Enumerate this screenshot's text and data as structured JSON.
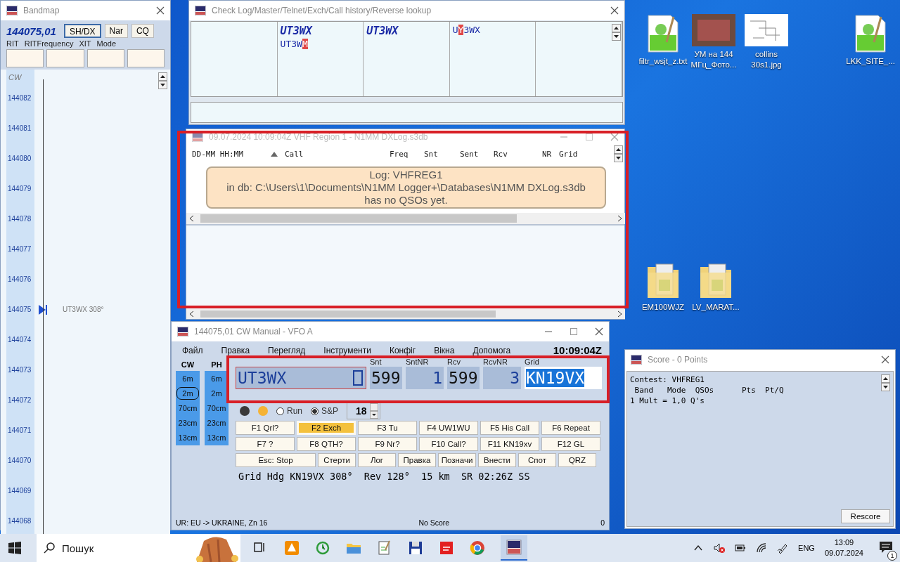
{
  "bandmap": {
    "title": "Bandmap",
    "frequency": "144075,01",
    "buttons": [
      {
        "label": "SH/DX",
        "selected": true
      },
      {
        "label": "Nar",
        "selected": false
      },
      {
        "label": "CQ",
        "selected": false
      }
    ],
    "field_labels": [
      "RIT",
      "RITFrequency",
      "XIT",
      "Mode"
    ],
    "mode": "CW",
    "scale": [
      {
        "freq": "144082"
      },
      {
        "freq": "144081"
      },
      {
        "freq": "144080"
      },
      {
        "freq": "144079"
      },
      {
        "freq": "144078"
      },
      {
        "freq": "144077"
      },
      {
        "freq": "144076"
      },
      {
        "freq": "144075",
        "spot": "UT3WX 308°"
      },
      {
        "freq": "144074"
      },
      {
        "freq": "144073"
      },
      {
        "freq": "144072"
      },
      {
        "freq": "144071"
      },
      {
        "freq": "144070"
      },
      {
        "freq": "144069"
      },
      {
        "freq": "144068"
      }
    ]
  },
  "check_log": {
    "title": "Check Log/Master/Telnet/Exch/Call history/Reverse lookup",
    "columns": [
      {},
      {
        "entries": [
          {
            "kind": "exact",
            "text": "UT3WX"
          },
          {
            "kind": "partial",
            "before": "UT3W",
            "diff": "M"
          }
        ]
      },
      {
        "entries": [
          {
            "kind": "exact",
            "text": "UT3WX"
          }
        ]
      },
      {
        "entries": [
          {
            "kind": "partial",
            "before": "U",
            "diff": "Y",
            "after": "3WX"
          }
        ]
      },
      {}
    ]
  },
  "log": {
    "title": "09.07.2024 10:09:04Z  VHF Region 1 - N1MM DXLog.s3db",
    "columns": [
      {
        "label": "DD-MM HH:MM",
        "sorted": false
      },
      {
        "label": "Call",
        "sorted": true
      },
      {
        "label": "Freq",
        "sorted": false
      },
      {
        "label": "Snt",
        "sorted": false
      },
      {
        "label": "Sent",
        "sorted": false
      },
      {
        "label": "Rcv",
        "sorted": false
      },
      {
        "label": "NR",
        "sorted": false
      },
      {
        "label": "Grid",
        "sorted": false
      }
    ],
    "message": [
      "Log: VHFREG1",
      "in db: C:\\Users\\1\\Documents\\N1MM Logger+\\Databases\\N1MM DXLog.s3db",
      "has no QSOs yet."
    ]
  },
  "entry": {
    "title": "144075,01 CW Manual - VFO A",
    "menu": [
      "Файл",
      "Правка",
      "Перегляд",
      "Інструменти",
      "Конфіг",
      "Вікна",
      "Допомога"
    ],
    "clock": "10:09:04Z",
    "band_columns": [
      {
        "label": "CW",
        "bands": [
          {
            "label": "6m",
            "selected": false
          },
          {
            "label": "2m",
            "selected": true
          },
          {
            "label": "70cm",
            "selected": false
          },
          {
            "label": "23cm",
            "selected": false
          },
          {
            "label": "13cm",
            "selected": false
          }
        ]
      },
      {
        "label": "PH",
        "bands": [
          {
            "label": "6m",
            "selected": false
          },
          {
            "label": "2m",
            "selected": false
          },
          {
            "label": "70cm",
            "selected": false
          },
          {
            "label": "23cm",
            "selected": false
          },
          {
            "label": "13cm",
            "selected": false
          }
        ]
      }
    ],
    "fields": [
      {
        "kind": "call",
        "value": "UT3WX",
        "selected": false
      },
      {
        "kind": "plain",
        "label": "Snt",
        "value": "599",
        "selected": false
      },
      {
        "kind": "number",
        "label": "SntNR",
        "value": "1",
        "selected": false
      },
      {
        "kind": "plain",
        "label": "Rcv",
        "value": "599",
        "selected": false
      },
      {
        "kind": "number",
        "label": "RcvNR",
        "value": "3",
        "selected": false
      },
      {
        "kind": "plain",
        "label": "Grid",
        "value": "KN19VX",
        "selected": true
      }
    ],
    "status_dots": [
      {
        "color": "#3a3a3a"
      },
      {
        "color": "#f5b335"
      }
    ],
    "modes": [
      {
        "label": "Run",
        "selected": false
      },
      {
        "label": "S&P",
        "selected": true
      }
    ],
    "spin_value": "18",
    "function_keys": [
      {
        "label": "F1 Qrl?",
        "selected": false
      },
      {
        "label": "F2 Exch",
        "selected": true
      },
      {
        "label": "F3 Tu",
        "selected": false
      },
      {
        "label": "F4 UW1WU",
        "selected": false
      },
      {
        "label": "F5 His Call",
        "selected": false
      },
      {
        "label": "F6 Repeat",
        "selected": false
      },
      {
        "label": "F7 ?",
        "selected": false
      },
      {
        "label": "F8 QTH?",
        "selected": false
      },
      {
        "label": "F9 Nr?",
        "selected": false
      },
      {
        "label": "F10 Call?",
        "selected": false
      },
      {
        "label": "F11 KN19xv",
        "selected": false
      },
      {
        "label": "F12 GL",
        "selected": false
      }
    ],
    "action_buttons": [
      "Esc: Stop",
      "Стерти",
      "Лог",
      "Правка",
      "Позначи",
      "Внести",
      "Спот",
      "QRZ"
    ],
    "info": "Grid Hdg KN19VX 308°  Rev 128°  15 km  SR 02:26Z SS",
    "status_bar": [
      "UR: EU -> UKRAINE, Zn 16",
      "No Score",
      "0"
    ]
  },
  "score": {
    "title": "Score - 0 Points",
    "lines": [
      "Contest: VHFREG1",
      " Band   Mode  QSOs      Pts  Pt/Q",
      "1 Mult = 1,0 Q's"
    ],
    "button": "Rescore"
  },
  "desktop_icons": [
    {
      "kind": "document",
      "label": "filtr_wsjt_z.txt"
    },
    {
      "kind": "photo",
      "label": "УМ на 144 МГц_Фото..."
    },
    {
      "kind": "sketch",
      "label": "collins 30s1.jpg"
    },
    {
      "kind": "document",
      "label": "LKK_SITE_..."
    },
    {
      "kind": "folder",
      "label": "EM100WJZ"
    },
    {
      "kind": "folder",
      "label": "LV_MARAT..."
    }
  ],
  "taskbar": {
    "search_placeholder": "Пошук",
    "language": "ENG",
    "time": "13:09",
    "date": "09.07.2024",
    "notifications": "1"
  }
}
